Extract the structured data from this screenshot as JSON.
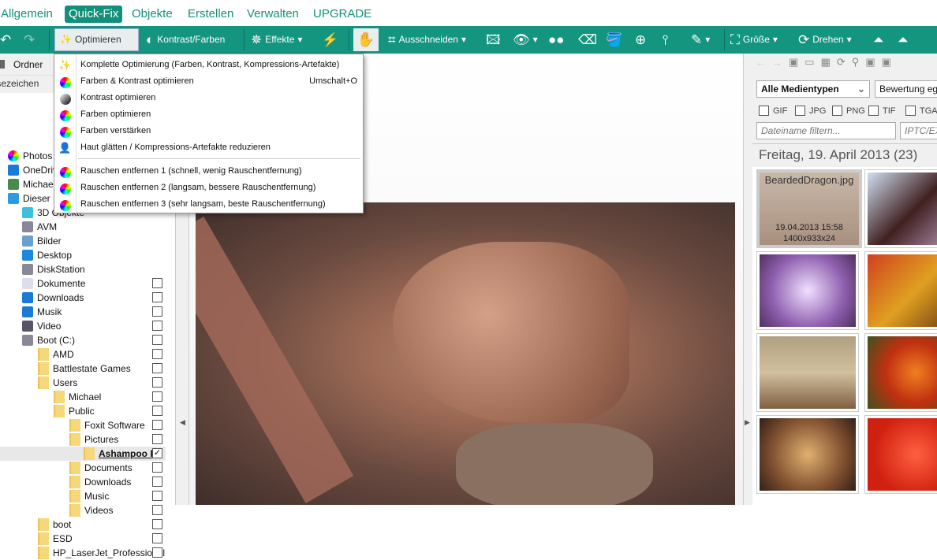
{
  "menubar": {
    "tabs": [
      "Allgemein",
      "Quick-Fix",
      "Objekte",
      "Erstellen",
      "Verwalten",
      "UPGRADE"
    ],
    "active": "Quick-Fix"
  },
  "toolbar": {
    "optimize": "Optimieren",
    "contrast": "Kontrast/Farben",
    "effects": "Effekte",
    "crop": "Ausschneiden",
    "size": "Größe",
    "rotate": "Drehen"
  },
  "left": {
    "folder_tab": "Ordner",
    "bookmarks": "Lesezeichen",
    "tree": [
      {
        "label": "Photos",
        "level": 0,
        "icon": "photos-icon"
      },
      {
        "label": "OneDrive",
        "level": 0,
        "icon": "onedrive-icon"
      },
      {
        "label": "Michael",
        "level": 0,
        "icon": "user-icon"
      },
      {
        "label": "Dieser PC",
        "level": 0,
        "icon": "pc-icon"
      },
      {
        "label": "3D Objekte",
        "level": 1,
        "icon": "3d-icon"
      },
      {
        "label": "AVM",
        "level": 1,
        "icon": "network-drive-icon"
      },
      {
        "label": "Bilder",
        "level": 1,
        "icon": "pictures-icon"
      },
      {
        "label": "Desktop",
        "level": 1,
        "icon": "desktop-icon"
      },
      {
        "label": "DiskStation",
        "level": 1,
        "icon": "network-drive-icon"
      },
      {
        "label": "Dokumente",
        "level": 1,
        "icon": "document-icon",
        "cb": true
      },
      {
        "label": "Downloads",
        "level": 1,
        "icon": "download-icon",
        "cb": true
      },
      {
        "label": "Musik",
        "level": 1,
        "icon": "music-icon",
        "cb": true
      },
      {
        "label": "Video",
        "level": 1,
        "icon": "video-icon",
        "cb": true
      },
      {
        "label": "Boot (C:)",
        "level": 1,
        "icon": "drive-icon",
        "cb": true
      },
      {
        "label": "AMD",
        "level": 2,
        "icon": "folder-icon",
        "cb": true
      },
      {
        "label": "Battlestate Games",
        "level": 2,
        "icon": "folder-icon",
        "cb": true
      },
      {
        "label": "Users",
        "level": 2,
        "icon": "folder-icon",
        "cb": true
      },
      {
        "label": "Michael",
        "level": 3,
        "icon": "folder-icon",
        "cb": true
      },
      {
        "label": "Public",
        "level": 3,
        "icon": "folder-icon",
        "cb": true
      },
      {
        "label": "Foxit Software",
        "level": 4,
        "icon": "folder-icon",
        "cb": true
      },
      {
        "label": "Pictures",
        "level": 4,
        "icon": "folder-icon",
        "cb": true
      },
      {
        "label": "Ashampoo P",
        "level": 5,
        "icon": "folder-icon",
        "cb": true,
        "checked": true,
        "selected": true
      },
      {
        "label": "Documents",
        "level": 4,
        "icon": "folder-icon",
        "cb": true
      },
      {
        "label": "Downloads",
        "level": 4,
        "icon": "folder-icon",
        "cb": true
      },
      {
        "label": "Music",
        "level": 4,
        "icon": "folder-icon",
        "cb": true
      },
      {
        "label": "Videos",
        "level": 4,
        "icon": "folder-icon",
        "cb": true
      },
      {
        "label": "boot",
        "level": 2,
        "icon": "folder-icon",
        "cb": true
      },
      {
        "label": "ESD",
        "level": 2,
        "icon": "folder-icon",
        "cb": true
      },
      {
        "label": "HP_LaserJet_Professional",
        "level": 2,
        "icon": "folder-icon",
        "cb": true
      }
    ]
  },
  "menu": {
    "items": [
      {
        "label": "Komplette Optimierung (Farben, Kontrast, Kompressions-Artefakte)",
        "icon": "magic-wand-icon",
        "shortcut": ""
      },
      {
        "label": "Farben & Kontrast optimieren",
        "icon": "color-wheel-icon",
        "shortcut": "Umschalt+O"
      },
      {
        "label": "Kontrast optimieren",
        "icon": "contrast-icon",
        "shortcut": ""
      },
      {
        "label": "Farben optimieren",
        "icon": "color-star-icon",
        "shortcut": ""
      },
      {
        "label": "Farben verstärken",
        "icon": "color-wheel-icon",
        "shortcut": ""
      },
      {
        "label": "Haut glätten / Kompressions-Artefakte reduzieren",
        "icon": "person-icon",
        "shortcut": ""
      },
      {
        "label": "Rauschen entfernen 1 (schnell, wenig Rauschentfernung)",
        "icon": "color-wheel-icon",
        "shortcut": ""
      },
      {
        "label": "Rauschen entfernen 2 (langsam, bessere Rauschentfernung)",
        "icon": "color-wheel-icon",
        "shortcut": ""
      },
      {
        "label": "Rauschen entfernen 3 (sehr langsam, beste Rauschentfernung)",
        "icon": "color-wheel-icon",
        "shortcut": ""
      }
    ]
  },
  "right": {
    "media_type": "Alle Medientypen",
    "rating": "Bewertung egal",
    "formats": [
      "GIF",
      "JPG",
      "PNG",
      "TIF",
      "TGA"
    ],
    "filename_placeholder": "Dateiname filtern...",
    "iptc_placeholder": "IPTC/EXIF",
    "group_header": "Freitag, 19. April 2013 (23)",
    "thumb_selected": {
      "name": "BeardedDragon.jpg",
      "date": "19.04.2013 15:58",
      "dims": "1400x933x24"
    }
  },
  "colors": {
    "accent": "#14957f"
  }
}
